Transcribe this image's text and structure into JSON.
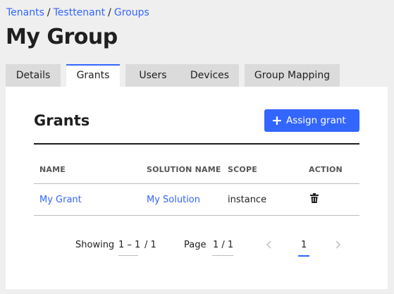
{
  "breadcrumb": {
    "items": [
      "Tenants",
      "Testtenant",
      "Groups"
    ],
    "separator": "/"
  },
  "page": {
    "title": "My Group"
  },
  "tabs": [
    {
      "label": "Details",
      "active": false
    },
    {
      "label": "Grants",
      "active": true
    },
    {
      "label": "Users",
      "active": false
    },
    {
      "label": "Devices",
      "active": false
    },
    {
      "label": "Group Mapping",
      "active": false
    }
  ],
  "grants": {
    "title": "Grants",
    "assign_button": {
      "icon": "plus-icon",
      "label": "Assign grant"
    },
    "columns": [
      "NAME",
      "SOLUTION NAME",
      "SCOPE",
      "ACTION"
    ],
    "rows": [
      {
        "name": "My Grant",
        "solution": "My Solution",
        "scope": "instance",
        "action_icon": "trash-icon"
      }
    ]
  },
  "pagination": {
    "showing_label": "Showing",
    "range": "1 – 1",
    "total": "/ 1",
    "page_label": "Page",
    "page_value": "1 / 1",
    "current_page": "1",
    "prev_icon": "chevron-left-icon",
    "next_icon": "chevron-right-icon"
  },
  "colors": {
    "accent": "#3366ff",
    "background": "#efefef",
    "tab_inactive": "#dbdbdb",
    "text": "#1f1f1f"
  }
}
